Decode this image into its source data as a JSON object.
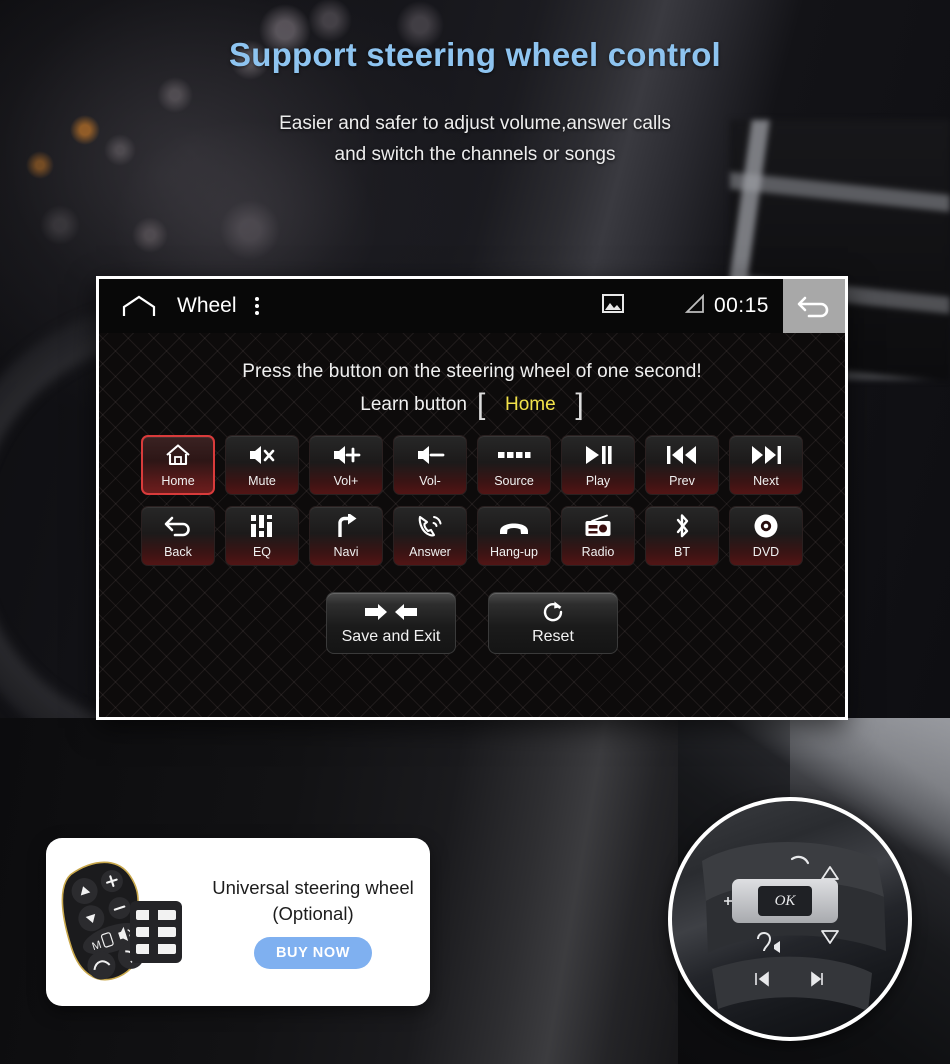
{
  "promo": {
    "headline": "Support steering wheel control",
    "subline_1": "Easier and safer to adjust volume,answer calls",
    "subline_2": "and switch the channels or songs",
    "headline_color": "#8ec4f0"
  },
  "head_unit": {
    "status_bar": {
      "home_icon": "home-outline-icon",
      "title": "Wheel",
      "overflow_icon": "more-vertical-icon",
      "picture_icon": "image-icon",
      "signal_icon": "signal-triangle-icon",
      "clock": "00:15",
      "back_icon": "back-arrow-icon"
    },
    "instruction": "Press the button on the steering wheel of one second!",
    "learn_label": "Learn button",
    "bracket_open": "[",
    "bracket_close": "]",
    "learn_value": "Home",
    "learn_value_color": "#f2e24a",
    "selected_key": "Home",
    "selected_border_color": "#d93b3b",
    "keys_row1": [
      {
        "label": "Home",
        "icon": "home-icon",
        "selected": true
      },
      {
        "label": "Mute",
        "icon": "speaker-mute-icon",
        "selected": false
      },
      {
        "label": "Vol+",
        "icon": "volume-up-icon",
        "selected": false
      },
      {
        "label": "Vol-",
        "icon": "volume-down-icon",
        "selected": false
      },
      {
        "label": "Source",
        "icon": "source-bars-icon",
        "selected": false
      },
      {
        "label": "Play",
        "icon": "play-pause-icon",
        "selected": false
      },
      {
        "label": "Prev",
        "icon": "previous-track-icon",
        "selected": false
      },
      {
        "label": "Next",
        "icon": "next-track-icon",
        "selected": false
      }
    ],
    "keys_row2": [
      {
        "label": "Back",
        "icon": "back-curved-arrow-icon",
        "selected": false
      },
      {
        "label": "EQ",
        "icon": "equalizer-icon",
        "selected": false
      },
      {
        "label": "Navi",
        "icon": "turn-right-arrow-icon",
        "selected": false
      },
      {
        "label": "Answer",
        "icon": "phone-ringing-icon",
        "selected": false
      },
      {
        "label": "Hang-up",
        "icon": "phone-hangup-icon",
        "selected": false
      },
      {
        "label": "Radio",
        "icon": "radio-icon",
        "selected": false
      },
      {
        "label": "BT",
        "icon": "bluetooth-icon",
        "selected": false
      },
      {
        "label": "DVD",
        "icon": "disc-icon",
        "selected": false
      }
    ],
    "actions": [
      {
        "label": "Save and Exit",
        "icon": "arrows-inward-icon"
      },
      {
        "label": "Reset",
        "icon": "refresh-icon"
      }
    ]
  },
  "product_card": {
    "title_line_1": "Universal steering wheel",
    "title_line_2": "(Optional)",
    "buy_label": "BUY NOW",
    "buy_color": "#7fb0f0",
    "image": "universal-steering-wheel-remote-photo"
  },
  "inset": {
    "image": "steering-wheel-buttons-closeup-photo",
    "ok_label": "OK"
  }
}
